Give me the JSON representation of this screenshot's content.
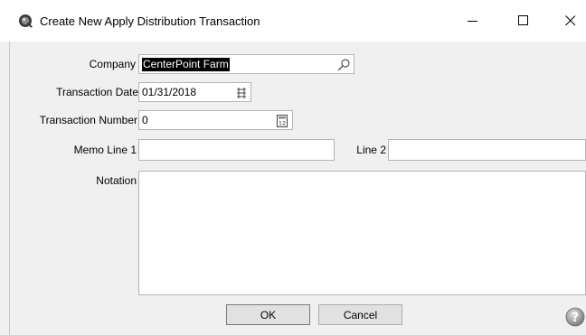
{
  "window": {
    "title": "Create New Apply Distribution Transaction",
    "controls": {
      "minimize": "—",
      "maximize": "☐",
      "close": "✕"
    }
  },
  "form": {
    "company": {
      "label": "Company",
      "value": "CenterPoint Farm",
      "icon": "search-icon"
    },
    "transaction_date": {
      "label": "Transaction Date",
      "value": "01/31/2018",
      "icon": "calendar-icon"
    },
    "transaction_number": {
      "label": "Transaction Number",
      "value": "0",
      "icon": "calculator-icon"
    },
    "memo_line_1": {
      "label": "Memo Line 1",
      "value": ""
    },
    "line_2": {
      "label": "Line 2",
      "value": ""
    },
    "notation": {
      "label": "Notation",
      "value": ""
    }
  },
  "buttons": {
    "ok": "OK",
    "cancel": "Cancel"
  },
  "colors": {
    "window_bg": "#f0f0f0",
    "field_border": "#b4b4b4",
    "selection": "#000000"
  }
}
